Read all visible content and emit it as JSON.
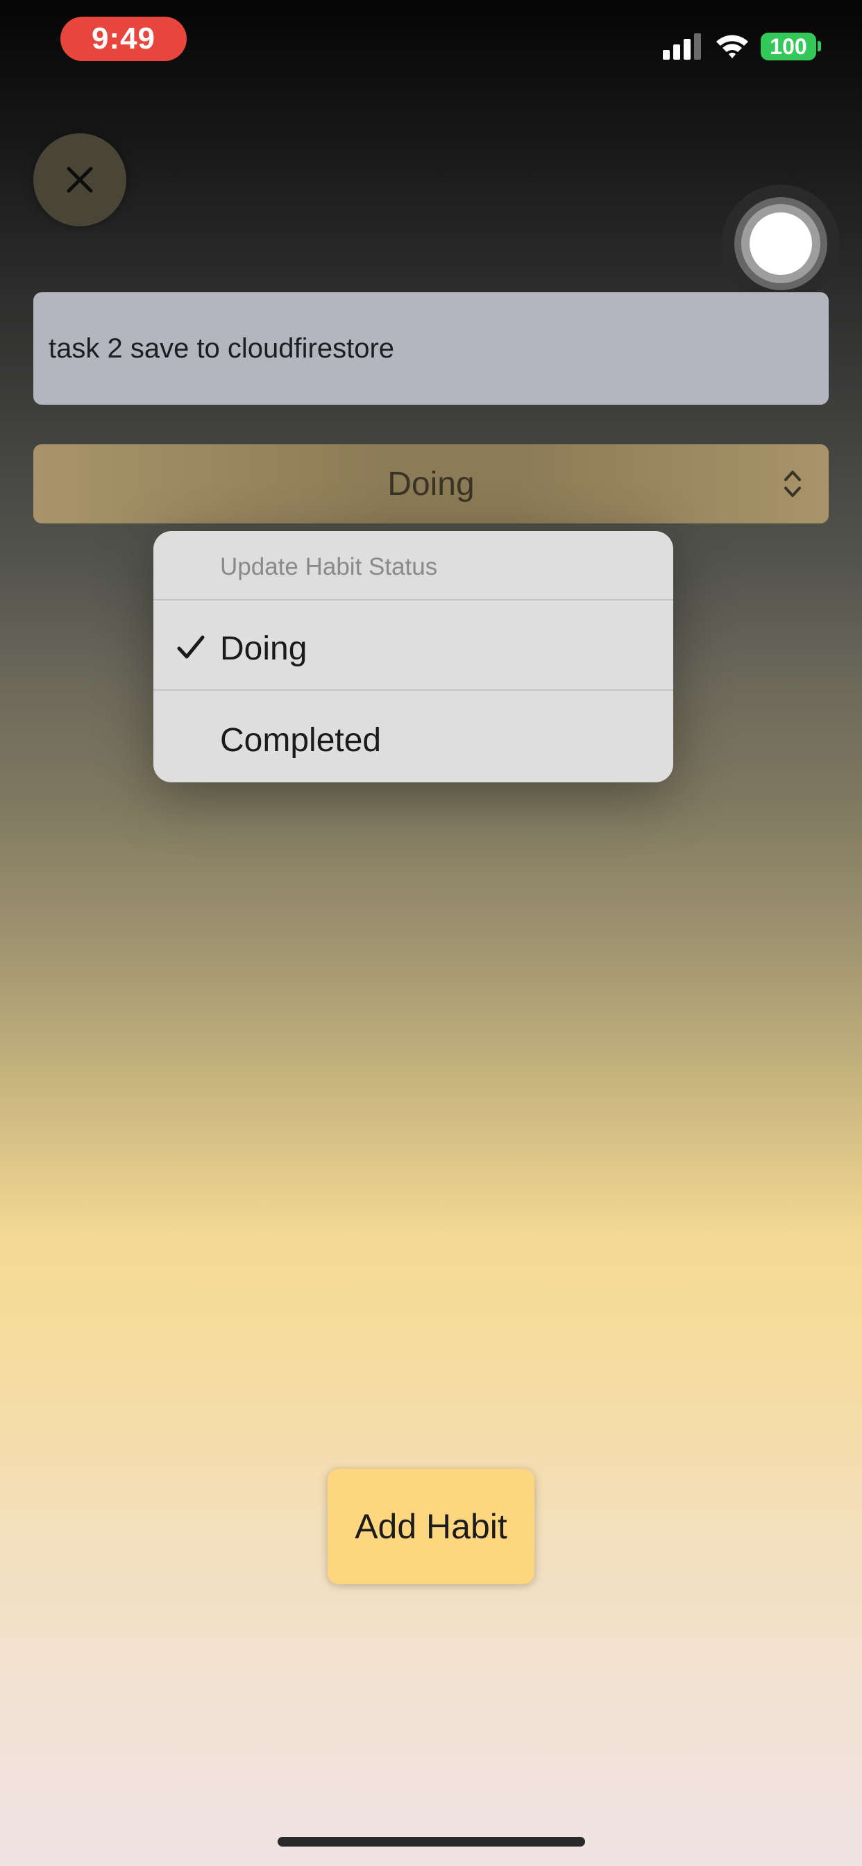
{
  "status_bar": {
    "time": "9:49",
    "battery_level": "100",
    "time_pill_color": "#e8463c",
    "battery_color": "#34c759"
  },
  "icons": {
    "close": "close-icon",
    "signal": "cellular-signal-icon",
    "wifi": "wifi-icon",
    "assistive_touch": "assistive-touch-icon",
    "picker_chevron": "chevron-updown-icon",
    "selected": "checkmark-icon"
  },
  "habit_name_field": {
    "value": "task 2 save to cloudfirestore"
  },
  "status_picker": {
    "selected_value": "Doing"
  },
  "status_menu": {
    "title": "Update Habit Status",
    "items": [
      {
        "label": "Doing",
        "selected": true
      },
      {
        "label": "Completed",
        "selected": false
      }
    ]
  },
  "add_habit_button": {
    "label": "Add Habit",
    "color": "#fdd67f"
  }
}
